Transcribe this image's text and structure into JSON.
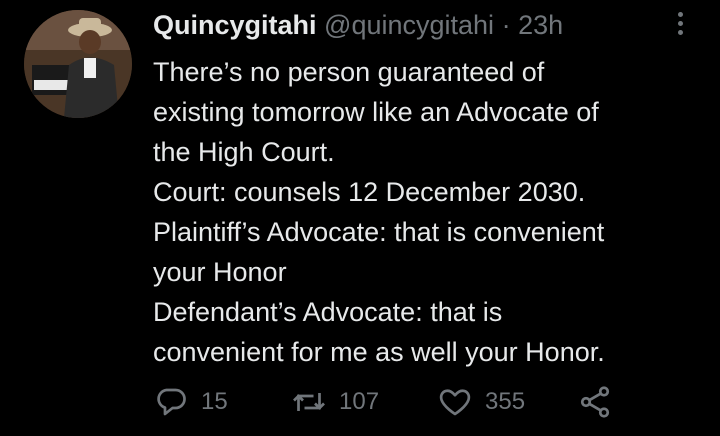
{
  "tweet": {
    "display_name": "Quincygitahi",
    "handle": "@quincygitahi",
    "separator": "·",
    "time": "23h",
    "lines": [
      "There’s no person guaranteed of",
      "existing tomorrow like an Advocate of",
      "the High Court.",
      "Court: counsels 12 December 2030.",
      "Plaintiff’s Advocate: that is convenient",
      "your Honor",
      "Defendant’s Advocate: that is",
      "convenient for me as well your Honor."
    ]
  },
  "actions": {
    "reply_count": "15",
    "retweet_count": "107",
    "like_count": "355"
  },
  "icons": {
    "more": "more-vertical-icon",
    "reply": "reply-icon",
    "retweet": "retweet-icon",
    "like": "heart-icon",
    "share": "share-icon"
  },
  "colors": {
    "background": "#000000",
    "text": "#e7e9ea",
    "muted": "#71767b"
  }
}
